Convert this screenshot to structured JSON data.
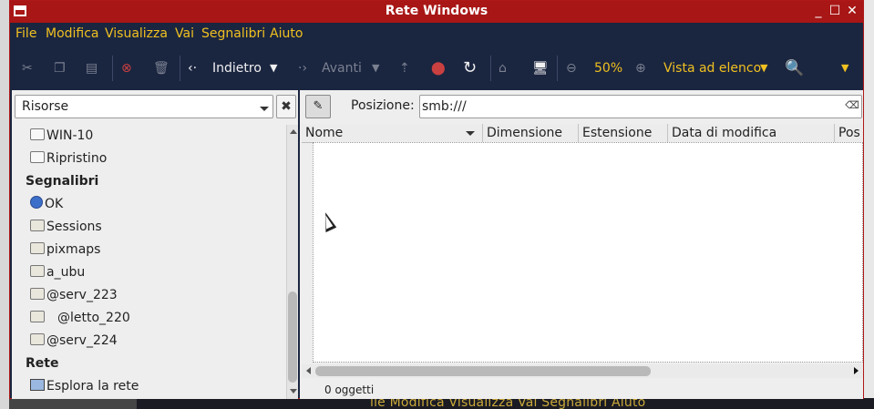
{
  "window": {
    "title": "Rete Windows"
  },
  "menu": [
    "File",
    "Modifica",
    "Visualizza",
    "Vai",
    "Segnalibri",
    "Aiuto"
  ],
  "toolbar": {
    "back_label": "Indietro",
    "forward_label": "Avanti",
    "zoom_level": "50%",
    "view_mode": "Vista ad elenco"
  },
  "sidepanel": {
    "selector": "Risorse",
    "items_top": [
      "WIN-10",
      "Ripristino"
    ],
    "bookmarks_header": "Segnalibri",
    "bookmarks": [
      "OK",
      "Sessions",
      "pixmaps",
      "a_ubu",
      "@serv_223",
      "@letto_220",
      "@serv_224"
    ],
    "network_header": "Rete",
    "network": [
      "Esplora la rete"
    ]
  },
  "location": {
    "label": "Posizione:",
    "value": "smb:///"
  },
  "columns": [
    "Nome",
    "Dimensione",
    "Estensione",
    "Data di modifica",
    "Pos"
  ],
  "status": "0 oggetti",
  "background_menu_ghost": "ile  Modifica  Visualizza  Vai  Segnalibri  Aiuto",
  "colors": {
    "title_bar": "#a81616",
    "menu_text": "#f0c020",
    "toolbar_bg": "#1a2540"
  }
}
